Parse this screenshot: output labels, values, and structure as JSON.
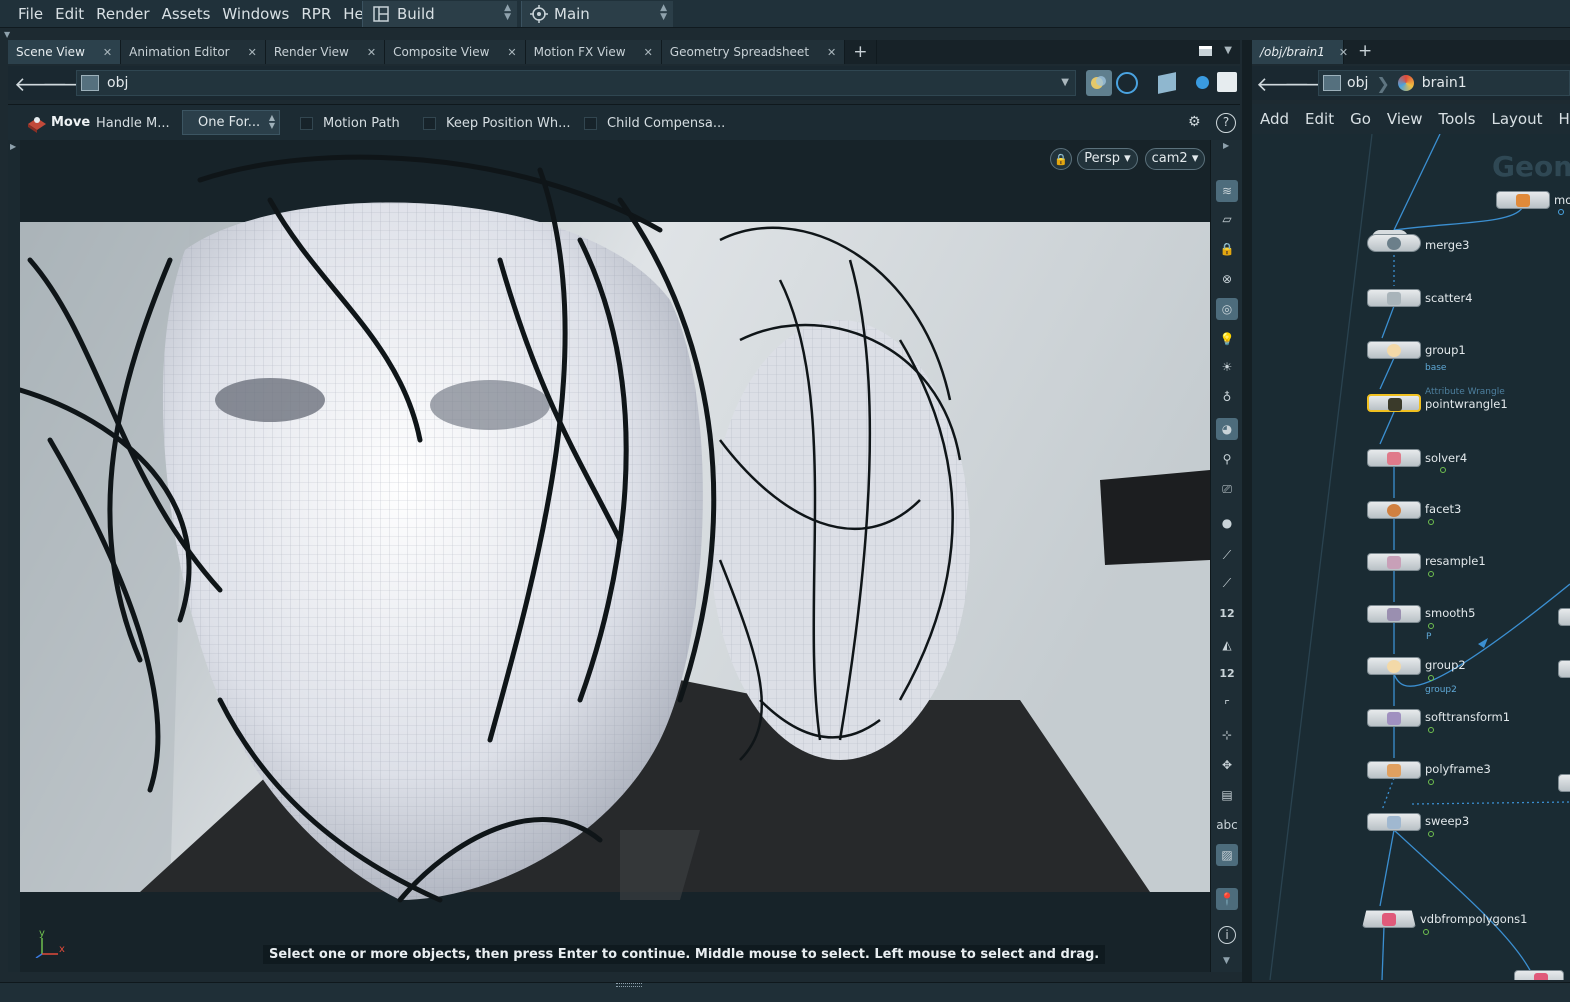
{
  "menubar": {
    "items": [
      "File",
      "Edit",
      "Render",
      "Assets",
      "Windows",
      "RPR",
      "Help"
    ],
    "desktop_label": "Build",
    "main_label": "Main"
  },
  "left_pane": {
    "tabs": [
      {
        "label": "Scene View",
        "active": true
      },
      {
        "label": "Animation Editor"
      },
      {
        "label": "Render View"
      },
      {
        "label": "Composite View"
      },
      {
        "label": "Motion FX View"
      },
      {
        "label": "Geometry Spreadsheet"
      }
    ],
    "add_tab": "+",
    "path": "obj",
    "tool": {
      "name": "Move",
      "handle": "Handle M...",
      "mode": "One For...",
      "options": [
        "Motion Path",
        "Keep Position Wh...",
        "Child Compensa..."
      ]
    },
    "viewport": {
      "camera_mode": "Persp",
      "camera": "cam2",
      "axis_y": "y",
      "axis_x": "x",
      "prompt": "Select one or more objects, then press Enter to continue. Middle mouse to select. Left mouse to select and drag."
    },
    "right_tools": {
      "label_12a": "12",
      "label_12b": "12",
      "label_abc": "abc"
    }
  },
  "right_pane": {
    "tab_label": "/obj/brain1",
    "add_tab": "+",
    "path_obj": "obj",
    "path_node": "brain1",
    "menu": [
      "Add",
      "Edit",
      "Go",
      "View",
      "Tools",
      "Layout",
      "He"
    ],
    "watermark": "Geom",
    "nodes": [
      {
        "name": "merge3"
      },
      {
        "name": "scatter4"
      },
      {
        "name": "group1",
        "sub": "base"
      },
      {
        "name": "pointwrangle1",
        "type": "Attribute Wrangle"
      },
      {
        "name": "solver4"
      },
      {
        "name": "facet3"
      },
      {
        "name": "resample1"
      },
      {
        "name": "smooth5",
        "sub": "P"
      },
      {
        "name": "group2",
        "sub": "group2"
      },
      {
        "name": "softtransform1"
      },
      {
        "name": "polyframe3"
      },
      {
        "name": "sweep3"
      },
      {
        "name": "vdbfrompolygons1"
      }
    ],
    "offscreen_node_label": "mo"
  }
}
